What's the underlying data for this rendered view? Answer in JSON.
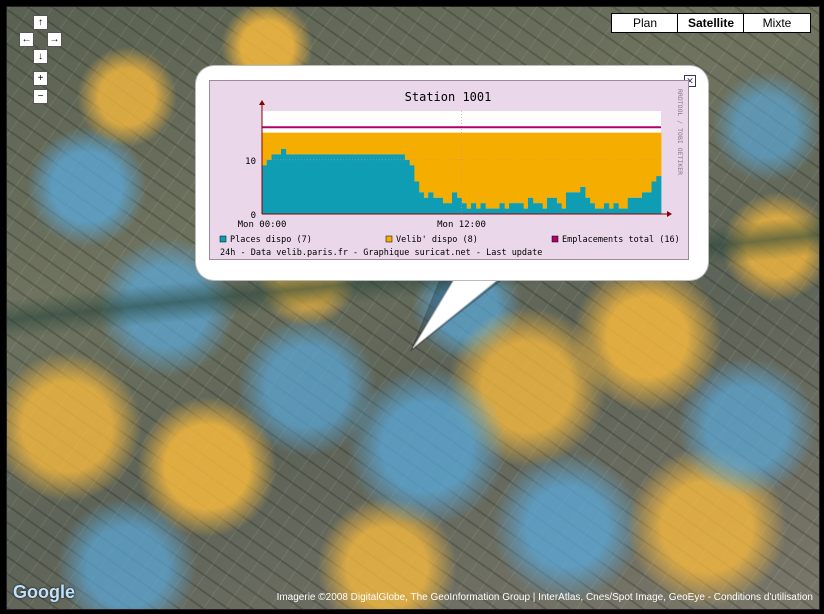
{
  "map": {
    "controls": {
      "pan_up": "↑",
      "pan_left": "←",
      "pan_right": "→",
      "pan_down": "↓",
      "zoom_in": "+",
      "zoom_out": "−"
    },
    "types": [
      {
        "label": "Plan",
        "active": false
      },
      {
        "label": "Satellite",
        "active": true
      },
      {
        "label": "Mixte",
        "active": false
      }
    ],
    "logo": "Google",
    "copyright": "Imagerie ©2008 DigitalGlobe, The GeoInformation Group | InterAtlas, Cnes/Spot Image, GeoEye - Conditions d'utilisation"
  },
  "popup": {
    "close": "✕",
    "watermark": "RRDTOOL / TOBI OETIKER",
    "legend": [
      {
        "label": "Places dispo (7)",
        "color": "#0e9db3"
      },
      {
        "label": "Velib' dispo (8)",
        "color": "#f5ae00"
      },
      {
        "label": "Emplacements total (16)",
        "color": "#b0006a"
      }
    ],
    "footer": "24h - Data velib.paris.fr - Graphique suricat.net - Last update"
  },
  "chart_data": {
    "type": "area",
    "title": "Station 1001",
    "x_tick_labels": [
      "Mon 00:00",
      "Mon 12:00"
    ],
    "y_tick_labels": [
      "0",
      "10"
    ],
    "ylim": [
      0,
      19
    ],
    "x_hours_range": [
      0,
      24
    ],
    "series": [
      {
        "name": "Places dispo",
        "color": "#0e9db3",
        "values": [
          9,
          10,
          11,
          11,
          12,
          11,
          11,
          11,
          11,
          11,
          11,
          11,
          11,
          11,
          11,
          11,
          11,
          11,
          11,
          11,
          11,
          11,
          11,
          11,
          11,
          11,
          11,
          11,
          11,
          11,
          10,
          9,
          6,
          4,
          3,
          4,
          3,
          3,
          2,
          2,
          4,
          3,
          2,
          1,
          2,
          1,
          2,
          1,
          1,
          1,
          2,
          1,
          2,
          2,
          2,
          1,
          3,
          2,
          2,
          1,
          3,
          3,
          2,
          1,
          4,
          4,
          4,
          5,
          3,
          2,
          1,
          1,
          2,
          1,
          2,
          1,
          1,
          3,
          3,
          3,
          4,
          4,
          6,
          7
        ]
      },
      {
        "name": "Velib' dispo",
        "color": "#f5ae00",
        "value_hint": "fills remainder up to 15"
      },
      {
        "name": "Emplacements total",
        "color": "#b0006a",
        "value": 16
      }
    ]
  }
}
